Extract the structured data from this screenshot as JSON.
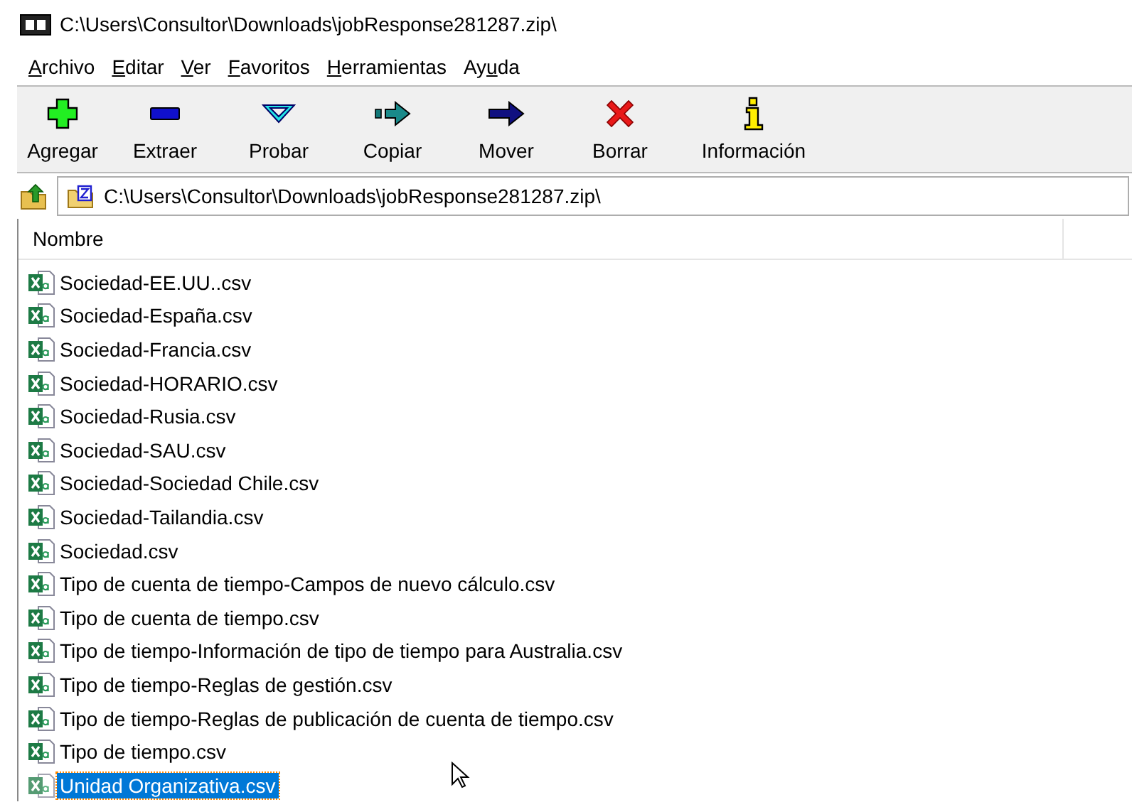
{
  "window": {
    "title": "C:\\Users\\Consultor\\Downloads\\jobResponse281287.zip\\"
  },
  "menu": [
    {
      "access_key": "A",
      "after": "rchivo"
    },
    {
      "access_key": "E",
      "after": "ditar"
    },
    {
      "access_key": "V",
      "after": "er"
    },
    {
      "access_key": "F",
      "after": "avoritos"
    },
    {
      "access_key": "H",
      "after": "erramientas"
    },
    {
      "before": "Ay",
      "access_key": "u",
      "after": "da"
    }
  ],
  "toolbar": [
    {
      "label": "Agregar",
      "kind": "add"
    },
    {
      "label": "Extraer",
      "kind": "extract"
    },
    {
      "label": "Probar",
      "kind": "test"
    },
    {
      "label": "Copiar",
      "kind": "copy"
    },
    {
      "label": "Mover",
      "kind": "move"
    },
    {
      "label": "Borrar",
      "kind": "delete"
    },
    {
      "label": "Información",
      "kind": "info"
    }
  ],
  "address_bar": {
    "value": "C:\\Users\\Consultor\\Downloads\\jobResponse281287.zip\\"
  },
  "file_list": {
    "columns": [
      "Nombre"
    ],
    "rows": [
      {
        "name": "Sociedad-EE.UU..csv",
        "selected": false
      },
      {
        "name": "Sociedad-España.csv",
        "selected": false
      },
      {
        "name": "Sociedad-Francia.csv",
        "selected": false
      },
      {
        "name": "Sociedad-HORARIO.csv",
        "selected": false
      },
      {
        "name": "Sociedad-Rusia.csv",
        "selected": false
      },
      {
        "name": "Sociedad-SAU.csv",
        "selected": false
      },
      {
        "name": "Sociedad-Sociedad Chile.csv",
        "selected": false
      },
      {
        "name": "Sociedad-Tailandia.csv",
        "selected": false
      },
      {
        "name": "Sociedad.csv",
        "selected": false
      },
      {
        "name": "Tipo de cuenta de tiempo-Campos de nuevo cálculo.csv",
        "selected": false
      },
      {
        "name": "Tipo de cuenta de tiempo.csv",
        "selected": false
      },
      {
        "name": "Tipo de tiempo-Información de tipo de tiempo para Australia.csv",
        "selected": false
      },
      {
        "name": "Tipo de tiempo-Reglas de gestión.csv",
        "selected": false
      },
      {
        "name": "Tipo de tiempo-Reglas de publicación de cuenta de tiempo.csv",
        "selected": false
      },
      {
        "name": "Tipo de tiempo.csv",
        "selected": false
      },
      {
        "name": "Unidad Organizativa.csv",
        "selected": true
      }
    ]
  }
}
